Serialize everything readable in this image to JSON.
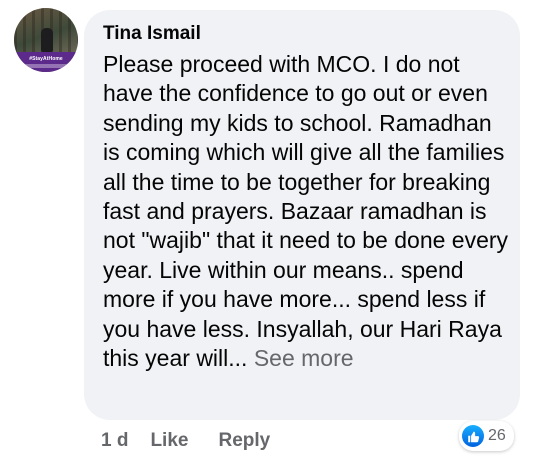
{
  "comment": {
    "author": "Tina Ismail",
    "avatar_frame_text": "#StayAtHome",
    "text": "Please proceed with MCO. I do not have the confidence to go out or even sending my kids to school. Ramadhan is coming which will give all the families all the time to be together for breaking fast and prayers. Bazaar ramadhan is not \"wajib\" that it need to be done every year. Live within our means.. spend more if you have more... spend less if you have less. Insyallah, our Hari Raya this year will...",
    "see_more_label": "See more",
    "time": "1 d",
    "like_label": "Like",
    "reply_label": "Reply",
    "reaction_icon": "like-icon",
    "reaction_count": "26"
  },
  "colors": {
    "bubble_bg": "#f0f2f5",
    "text": "#050505",
    "secondary": "#65676b",
    "like_blue": "#1877f2",
    "avatar_frame": "#5b2a8a"
  }
}
